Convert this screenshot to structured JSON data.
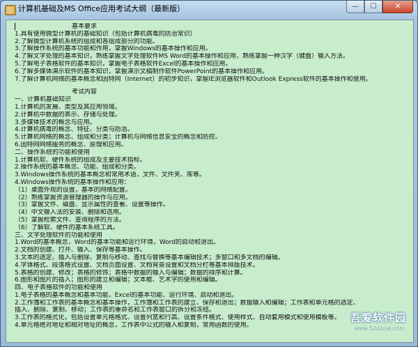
{
  "window": {
    "title": "计算机基础及MS Office应用考试大纲（最新版）",
    "buttons": {
      "minimize": "—",
      "maximize": "☐",
      "close": "✕"
    }
  },
  "document": {
    "req_heading": "基本要求",
    "req_lines": [
      "1.具有使用微型计算机的基础知识（包括计算机病毒的防治常识）",
      "2.了解微型计算机系统的组成和各组成部分的功能。",
      "3.了解操作系统的基本功能和作用，掌握Windows的基本操作和应用。",
      "4.了解文字处理的基本知识，熟练掌握文字处理软件MS Word的基本操作和应用，熟练掌握一种汉字（键盘）输入方法。",
      "5.了解电子表格软件的基本知识，掌握电子表格软件Excel的基本操作和应用。",
      "6.了解多媒体演示软件的基本知识，掌握演示文稿制作软件PowerPoint的基本操作和应用。",
      "7.了解计算机网络的基本概念和因特网（Internet）的初步知识，掌握IE浏览器软件和Outlook Express软件的基本操作和使用。"
    ],
    "exam_heading": "考试内容",
    "exam_lines": [
      "一、计算机基础知识",
      "1.计算机的发展、类型及其应用领域。",
      "2.计算机中数据的表示、存储与处理。",
      "3.多媒体技术的概念与应用。",
      "4.计算机病毒的概念、特征、分类与防治。",
      "5.计算机网络的概念、组成和分类；计算机与网络信息安全的概念和防控。",
      "6.因特网网络服务的概念、原理和应用。",
      "二、操作系统的功能和使用",
      "1.计算机软、硬件系统的组成及主要技术指标。",
      "2.操作系统的基本概念、功能、组成和分类。",
      "3.Windows操作系统的基本概念和常用术语，文件、文件夹、库等。",
      "4.Windows操作系统的基本操作和应用：",
      "（1）桌面外观的设置，基本的网络配置。",
      "（2）熟练掌握资源管理器的操作与应用。",
      "（3）掌握文件、磁盘、显示属性的查看、设置等操作。",
      "（4）中文输入法的安装、删除和选用。",
      "（5）掌握检索文件、查询程序的方法。",
      "（6）了解软、硬件的基本系统工具。",
      "三、文字处理软件的功能和使用",
      "1.Word的基本概念，Word的基本功能和运行环境，Word的启动和退出。",
      "2.文档的创建、打开、输入、保存等基本操作。",
      "3.文本的选定、插入与删除、复制与移动、查找与替换等基本编辑技术；多窗口和多文档的编辑。",
      "4.字体格式、段落格式设置、文档页面设置、文档背景设置和文档分栏等基本排版技术。",
      "5.表格的创建、修改；表格的修饰；表格中数据的输入与编辑；数据的排序和计算。",
      "6.图形和图片的插入；图形的建立和编辑；文本框、艺术字的使用和编辑。",
      "四、电子表格软件的功能和使用",
      "1.电子表格的基本概念和基本功能，Excel的基本功能、运行环境、启动和退出。",
      "2.工作簿和工作表的基本概念和基本操作，工作簿和工作表的建立、保存和退出；数据输入和编辑；工作表和单元格的选定、",
      "插入、删除、复制、移动；工作表的重命名和工作表窗口的拆分和冻结。",
      "3.工作表的格式化，包括设置单元格格式、设置列宽和行高、设置条件格式、使用样式、自动套用模式和使用模板等。",
      "4.单元格绝对地址和相对地址的概念，工作表中公式的输入和复制，常用函数的使用。"
    ]
  },
  "watermark": {
    "text": "吾爱软件园",
    "url": "www.52zixue.com"
  }
}
